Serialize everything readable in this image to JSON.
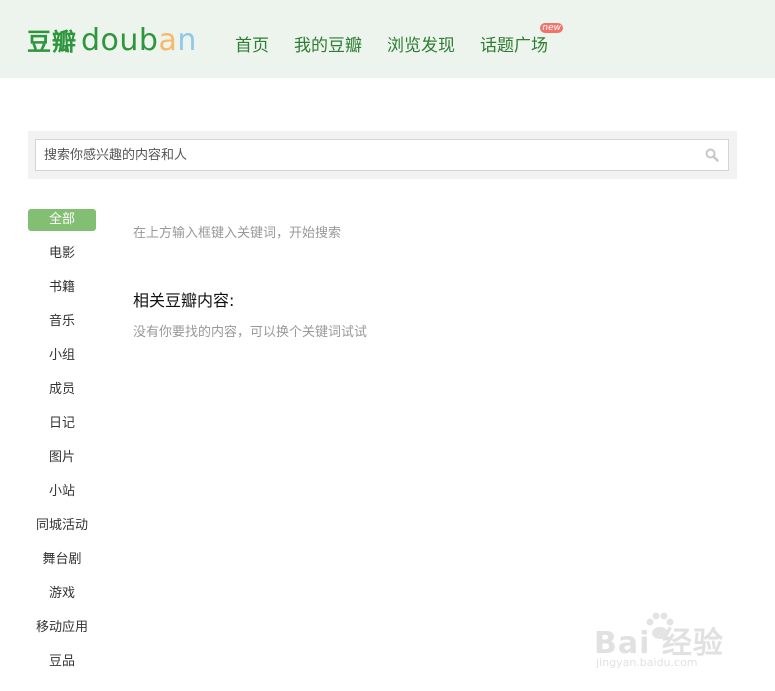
{
  "header": {
    "logo_cn": "豆瓣",
    "logo_en_letters": [
      "d",
      "o",
      "u",
      "b",
      "a",
      "n"
    ],
    "logo_en_colors": [
      "#2e963d",
      "#2e963d",
      "#2e963d",
      "#2e963d",
      "#f7b96b",
      "#8fc9e6"
    ],
    "nav": [
      "首页",
      "我的豆瓣",
      "浏览发现",
      "话题广场"
    ],
    "new_badge": "new"
  },
  "search": {
    "placeholder": "搜索你感兴趣的内容和人",
    "value": ""
  },
  "sidebar": {
    "items": [
      "全部",
      "电影",
      "书籍",
      "音乐",
      "小组",
      "成员",
      "日记",
      "图片",
      "小站",
      "同城活动",
      "舞台剧",
      "游戏",
      "移动应用",
      "豆品"
    ],
    "active_index": 0
  },
  "main": {
    "hint": "在上方输入框键入关键词，开始搜索",
    "related_title": "相关豆瓣内容:",
    "related_empty": "没有你要找的内容，可以换个关键词试试"
  },
  "watermark": {
    "text": "Bai 经验",
    "sub": "jingyan.baidu.com"
  },
  "colors": {
    "header_bg": "#edf4ed",
    "brand_green": "#2e963d",
    "nav_green": "#2e7d32",
    "active_tab": "#83bf73",
    "badge": "#f0736b"
  }
}
